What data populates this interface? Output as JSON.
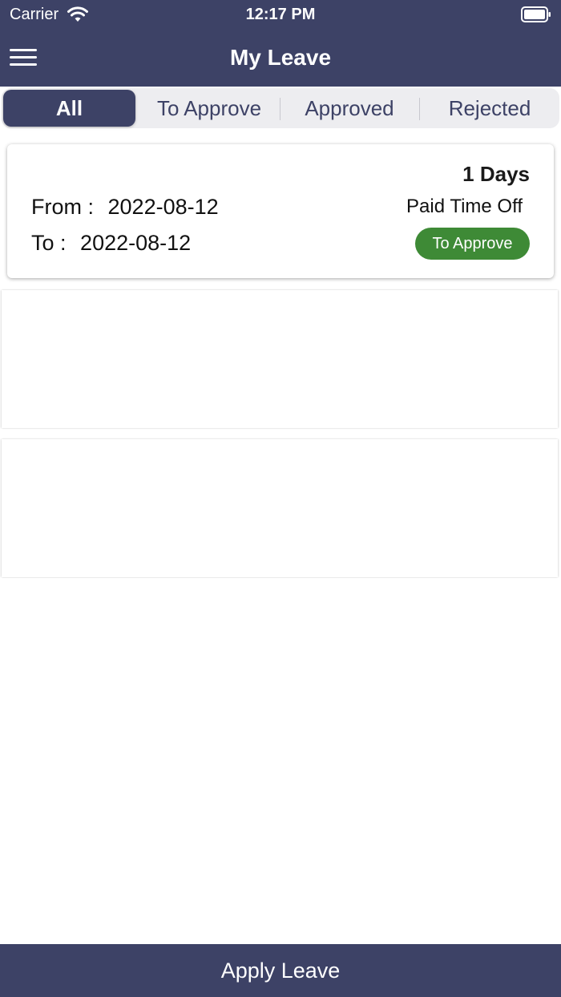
{
  "status_bar": {
    "carrier": "Carrier",
    "time": "12:17 PM"
  },
  "header": {
    "title": "My Leave",
    "menu_icon": "hamburger-menu-icon"
  },
  "tabs": [
    {
      "label": "All",
      "selected": true
    },
    {
      "label": "To Approve",
      "selected": false
    },
    {
      "label": "Approved",
      "selected": false
    },
    {
      "label": "Rejected",
      "selected": false
    }
  ],
  "leaves": [
    {
      "days": "1 Days",
      "from_label": "From :",
      "from_date": "2022-08-12",
      "to_label": "To :",
      "to_date": "2022-08-12",
      "leave_type": "Paid Time Off",
      "status": "To Approve"
    }
  ],
  "footer": {
    "apply_label": "Apply Leave"
  },
  "colors": {
    "primary": "#3d4266",
    "status_to_approve": "#3e8a36",
    "segment_background": "#ededf0"
  }
}
